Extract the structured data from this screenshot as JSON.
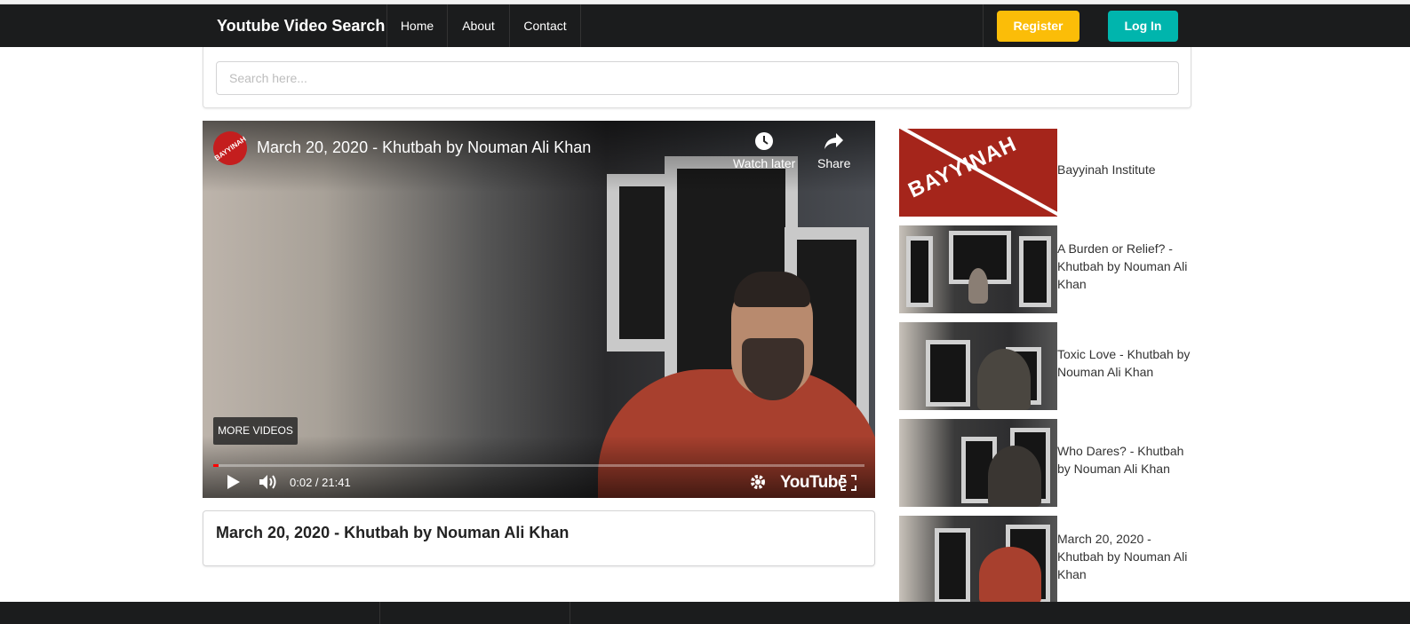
{
  "navbar": {
    "brand": "Youtube Video Search",
    "links": [
      "Home",
      "About",
      "Contact"
    ],
    "register_label": "Register",
    "login_label": "Log In",
    "register_color": "#fbbd08",
    "login_color": "#00b5ad"
  },
  "search": {
    "placeholder": "Search here...",
    "value": ""
  },
  "player": {
    "channel_logo_text": "BAYYINAH",
    "title": "March 20, 2020 - Khutbah by Nouman Ali Khan",
    "watch_later_label": "Watch later",
    "share_label": "Share",
    "more_videos_label": "MORE VIDEOS",
    "time_display": "0:02 / 21:41",
    "progress_fraction": 0.0015,
    "brand_label": "YouTube",
    "icons": [
      "clock-icon",
      "share-arrow-icon",
      "play-icon",
      "volume-icon",
      "settings-gear-icon",
      "fullscreen-icon"
    ]
  },
  "main": {
    "video_title": "March 20, 2020 - Khutbah by Nouman Ali Khan"
  },
  "sidebar": {
    "items": [
      {
        "label": "Bayyinah Institute",
        "thumb_text": "BAYYINAH"
      },
      {
        "label": "A Burden or Relief? - Khutbah by Nouman Ali Khan"
      },
      {
        "label": "Toxic Love - Khutbah by Nouman Ali Khan"
      },
      {
        "label": "Who Dares? - Khutbah by Nouman Ali Khan"
      },
      {
        "label": "March 20, 2020 - Khutbah by Nouman Ali Khan"
      }
    ]
  }
}
